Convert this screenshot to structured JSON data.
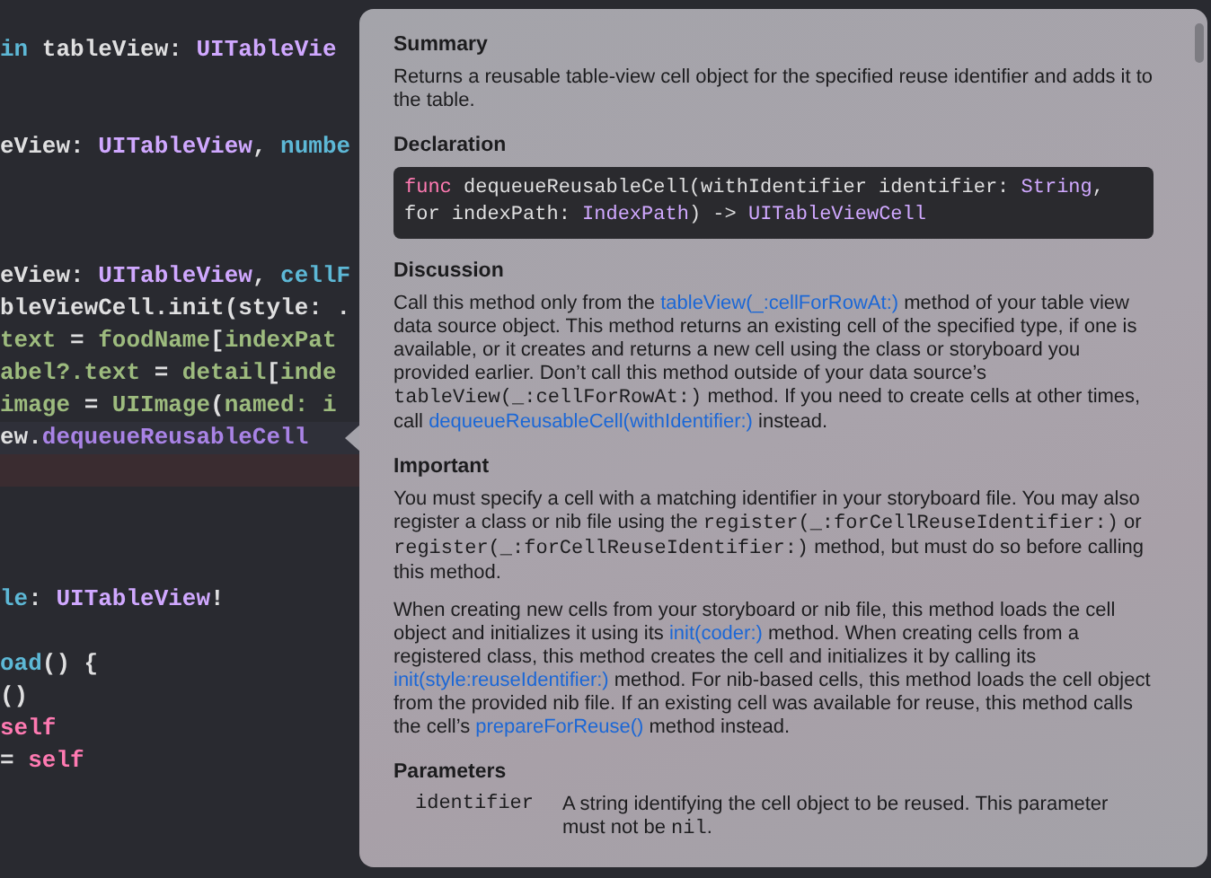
{
  "editor": {
    "lines": [
      {
        "kind": "code",
        "tokens": [
          {
            "kind": "decl",
            "text": "in"
          },
          {
            "kind": "plain",
            "text": " tableView: "
          },
          {
            "kind": "type",
            "text": "UITableVie"
          }
        ]
      },
      {
        "kind": "blank"
      },
      {
        "kind": "blank"
      },
      {
        "kind": "code",
        "tokens": [
          {
            "kind": "plain",
            "text": "eView: "
          },
          {
            "kind": "type",
            "text": "UITableView"
          },
          {
            "kind": "plain",
            "text": ", "
          },
          {
            "kind": "decl",
            "text": "numbe"
          }
        ]
      },
      {
        "kind": "blank"
      },
      {
        "kind": "blank"
      },
      {
        "kind": "blank"
      },
      {
        "kind": "code",
        "tokens": [
          {
            "kind": "plain",
            "text": "eView: "
          },
          {
            "kind": "type",
            "text": "UITableView"
          },
          {
            "kind": "plain",
            "text": ", "
          },
          {
            "kind": "decl",
            "text": "cellF"
          }
        ]
      },
      {
        "kind": "code",
        "tokens": [
          {
            "kind": "plain",
            "text": "bleViewCell.init(style: ."
          }
        ]
      },
      {
        "kind": "code",
        "tokens": [
          {
            "kind": "project",
            "text": "text"
          },
          {
            "kind": "plain",
            "text": " = "
          },
          {
            "kind": "project",
            "text": "foodName"
          },
          {
            "kind": "plain",
            "text": "["
          },
          {
            "kind": "project",
            "text": "indexPat"
          }
        ]
      },
      {
        "kind": "code",
        "tokens": [
          {
            "kind": "project",
            "text": "abel?.text"
          },
          {
            "kind": "plain",
            "text": " = "
          },
          {
            "kind": "project",
            "text": "detail"
          },
          {
            "kind": "plain",
            "text": "["
          },
          {
            "kind": "project",
            "text": "inde"
          }
        ]
      },
      {
        "kind": "code",
        "tokens": [
          {
            "kind": "project",
            "text": "image"
          },
          {
            "kind": "plain",
            "text": " = "
          },
          {
            "kind": "project",
            "text": "UIImage"
          },
          {
            "kind": "plain",
            "text": "("
          },
          {
            "kind": "project",
            "text": "named: i"
          }
        ]
      },
      {
        "kind": "code",
        "current": true,
        "tokens": [
          {
            "kind": "plain",
            "text": "ew."
          },
          {
            "kind": "method",
            "text": "dequeueReusableCell"
          }
        ]
      },
      {
        "kind": "error"
      },
      {
        "kind": "blank"
      },
      {
        "kind": "blank"
      },
      {
        "kind": "blank"
      },
      {
        "kind": "code",
        "tokens": [
          {
            "kind": "decl",
            "text": "le"
          },
          {
            "kind": "plain",
            "text": ": "
          },
          {
            "kind": "type",
            "text": "UITableView"
          },
          {
            "kind": "plain",
            "text": "!"
          }
        ]
      },
      {
        "kind": "blank"
      },
      {
        "kind": "code",
        "tokens": [
          {
            "kind": "decl",
            "text": "oad"
          },
          {
            "kind": "plain",
            "text": "() {"
          }
        ]
      },
      {
        "kind": "code",
        "tokens": [
          {
            "kind": "plain",
            "text": "()"
          }
        ]
      },
      {
        "kind": "code",
        "tokens": [
          {
            "kind": "keyword",
            "text": "self"
          }
        ]
      },
      {
        "kind": "code",
        "tokens": [
          {
            "kind": "plain",
            "text": "= "
          },
          {
            "kind": "keyword",
            "text": "self"
          }
        ]
      }
    ]
  },
  "quick_help": {
    "sections": [
      {
        "kind": "text",
        "heading": "Summary",
        "paragraphs": [
          [
            {
              "kind": "text",
              "text": "Returns a reusable table-view cell object for the specified reuse identifier and adds it to the table."
            }
          ]
        ]
      },
      {
        "kind": "declaration",
        "heading": "Declaration",
        "lines": [
          [
            {
              "kind": "keyword",
              "text": "func"
            },
            {
              "kind": "plain",
              "text": " dequeueReusableCell(withIdentifier identifier: "
            },
            {
              "kind": "type",
              "text": "String"
            },
            {
              "kind": "plain",
              "text": ","
            }
          ],
          [
            {
              "kind": "plain",
              "text": "for indexPath: "
            },
            {
              "kind": "type",
              "text": "IndexPath"
            },
            {
              "kind": "plain",
              "text": ") -> "
            },
            {
              "kind": "type",
              "text": "UITableViewCell"
            }
          ]
        ]
      },
      {
        "kind": "text",
        "heading": "Discussion",
        "paragraphs": [
          [
            {
              "kind": "text",
              "text": "Call this method only from the "
            },
            {
              "kind": "link",
              "text": "tableView(_:cellForRowAt:)"
            },
            {
              "kind": "text",
              "text": " method of your table view data source object. This method returns an existing cell of the specified type, if one is available, or it creates and returns a new cell using the class or storyboard you provided earlier. Don’t call this method outside of your data source’s "
            },
            {
              "kind": "code",
              "text": "tableView(_:cellForRowAt:)"
            },
            {
              "kind": "text",
              "text": " method. If you need to create cells at other times, call "
            },
            {
              "kind": "link",
              "text": "dequeueReusableCell(withIdentifier:)"
            },
            {
              "kind": "text",
              "text": " instead."
            }
          ]
        ]
      },
      {
        "kind": "text",
        "heading": "Important",
        "paragraphs": [
          [
            {
              "kind": "text",
              "text": "You must specify a cell with a matching identifier in your storyboard file. You may also register a class or nib file using the "
            },
            {
              "kind": "code",
              "text": "register(_:forCellReuseIdentifier:)"
            },
            {
              "kind": "text",
              "text": " or "
            },
            {
              "kind": "code",
              "text": "register(_:forCellReuseIdentifier:)"
            },
            {
              "kind": "text",
              "text": " method, but must do so before calling this method."
            }
          ],
          [
            {
              "kind": "text",
              "text": "When creating new cells from your storyboard or nib file, this method loads the cell object and initializes it using its "
            },
            {
              "kind": "link",
              "text": "init(coder:)"
            },
            {
              "kind": "text",
              "text": " method. When creating cells from a registered class, this method creates the cell and initializes it by calling its "
            },
            {
              "kind": "link",
              "text": "init(style:reuseIdentifier:)"
            },
            {
              "kind": "text",
              "text": " method. For nib-based cells, this method loads the cell object from the provided nib file. If an existing cell was available for reuse, this method calls the cell’s "
            },
            {
              "kind": "link",
              "text": "prepareForReuse()"
            },
            {
              "kind": "text",
              "text": " method instead."
            }
          ]
        ]
      },
      {
        "kind": "parameters",
        "heading": "Parameters",
        "params": [
          {
            "name": "identifier",
            "description": [
              {
                "kind": "text",
                "text": "A string identifying the cell object to be reused. This parameter must not be "
              },
              {
                "kind": "code",
                "text": "nil"
              },
              {
                "kind": "text",
                "text": "."
              }
            ]
          }
        ]
      }
    ]
  }
}
